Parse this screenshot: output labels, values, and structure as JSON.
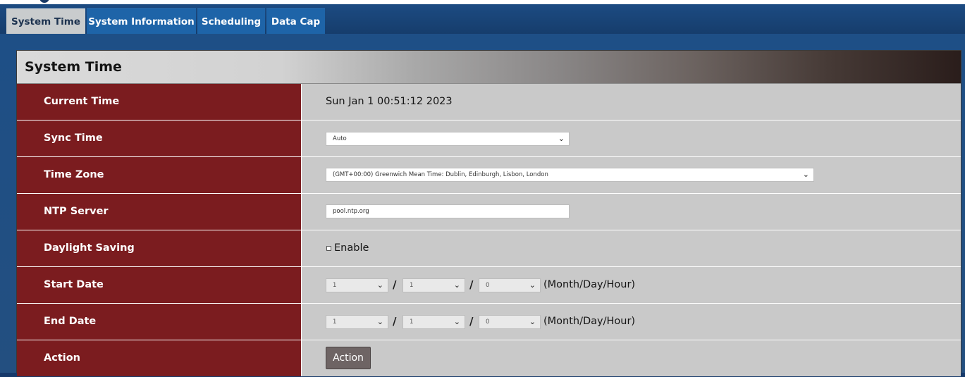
{
  "tabs": [
    {
      "label": "System Time",
      "active": true
    },
    {
      "label": "System Information",
      "active": false
    },
    {
      "label": "Scheduling",
      "active": false
    },
    {
      "label": "Data Cap",
      "active": false
    }
  ],
  "panel": {
    "title": "System Time",
    "rows": {
      "current_time": {
        "label": "Current Time",
        "value": "Sun Jan 1 00:51:12 2023"
      },
      "sync_time": {
        "label": "Sync Time",
        "selected": "Auto"
      },
      "time_zone": {
        "label": "Time Zone",
        "selected": "(GMT+00:00) Greenwich Mean Time: Dublin, Edinburgh, Lisbon, London"
      },
      "ntp_server": {
        "label": "NTP Server",
        "value": "pool.ntp.org"
      },
      "daylight_saving": {
        "label": "Daylight Saving",
        "checkbox_label": "Enable",
        "checked": false
      },
      "start_date": {
        "label": "Start Date",
        "month": "1",
        "day": "1",
        "hour": "0",
        "separator": "/",
        "format_hint": "(Month/Day/Hour)"
      },
      "end_date": {
        "label": "End Date",
        "month": "1",
        "day": "1",
        "hour": "0",
        "separator": "/",
        "format_hint": "(Month/Day/Hour)"
      },
      "action": {
        "label": "Action",
        "button_label": "Action"
      }
    }
  },
  "colors": {
    "page_bg": "#16396a",
    "tab_bg": "#1e64a8",
    "tab_active_bg": "#c9cccd",
    "label_bg": "#7b1c1f",
    "value_bg": "#c9c9c9",
    "action_button_bg": "#6e6464"
  },
  "icons": {
    "dropdown": "chevron-down-icon"
  }
}
